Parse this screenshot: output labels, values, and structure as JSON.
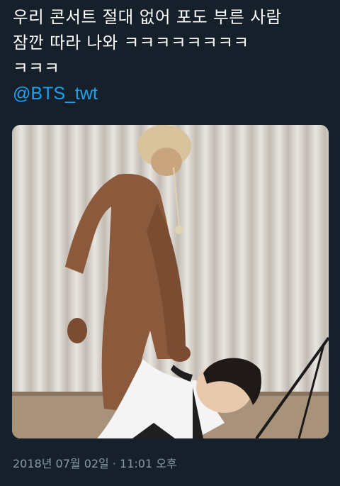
{
  "tweet": {
    "text": "우리 콘서트 절대 없어 포도 부른 사람\n잠깐 따라 나와 ㅋㅋㅋㅋㅋㅋㅋㅋ\nㅋㅋㅋ",
    "mention": "@BTS_twt",
    "timestamp": "2018년 07월 02일 · 11:01 오후"
  },
  "colors": {
    "background": "#15202b",
    "text": "#ffffff",
    "link": "#1da1f2",
    "meta": "#8899a6"
  }
}
